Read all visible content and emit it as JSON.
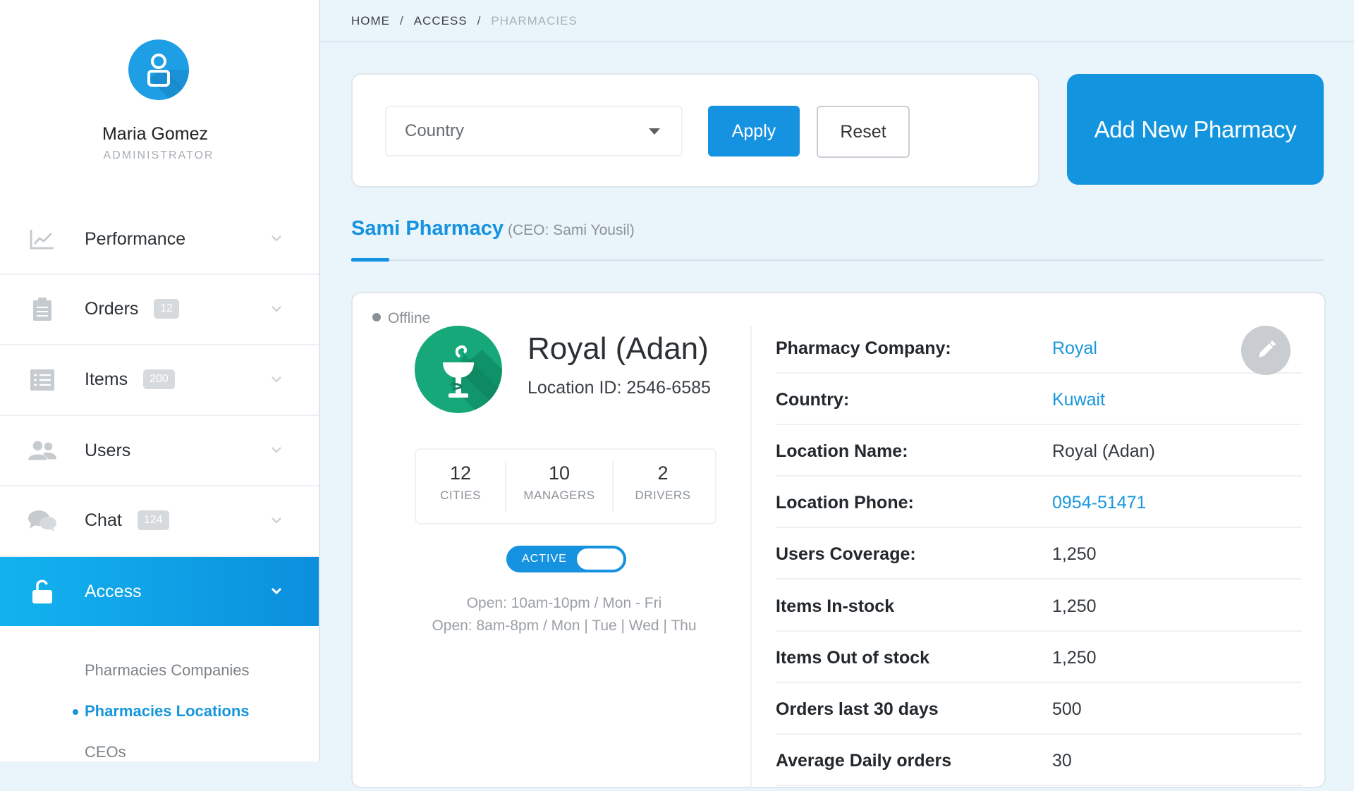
{
  "user": {
    "name": "Maria Gomez",
    "role": "ADMINISTRATOR"
  },
  "nav": {
    "items": [
      {
        "label": "Performance",
        "icon": "chart-icon",
        "badge": ""
      },
      {
        "label": "Orders",
        "icon": "clipboard-icon",
        "badge": "12"
      },
      {
        "label": "Items",
        "icon": "list-icon",
        "badge": "200"
      },
      {
        "label": "Users",
        "icon": "users-icon",
        "badge": ""
      },
      {
        "label": "Chat",
        "icon": "chat-icon",
        "badge": "124"
      },
      {
        "label": "Access",
        "icon": "unlock-icon",
        "badge": "",
        "active": true
      }
    ],
    "sub_items": [
      {
        "label": "Pharmacies Companies"
      },
      {
        "label": "Pharmacies Locations",
        "current": true
      },
      {
        "label": "CEOs"
      }
    ]
  },
  "breadcrumb": {
    "home": "HOME",
    "access": "ACCESS",
    "current": "PHARMACIES",
    "separator": "/"
  },
  "filter": {
    "country_placeholder": "Country",
    "apply_label": "Apply",
    "reset_label": "Reset"
  },
  "add_button_label": "Add New Pharmacy",
  "tab": {
    "name": "Sami Pharmacy",
    "ceo": "(CEO: Sami Yousil)"
  },
  "location": {
    "status": "Offline",
    "name": "Royal (Adan)",
    "location_id": "Location ID: 2546-6585",
    "stats": [
      {
        "value": "12",
        "label": "CITIES"
      },
      {
        "value": "10",
        "label": "MANAGERS"
      },
      {
        "value": "2",
        "label": "DRIVERS"
      }
    ],
    "toggle_label": "ACTIVE",
    "toggle_on": true,
    "hours": [
      "Open: 10am-10pm / Mon - Fri",
      "Open: 8am-8pm / Mon | Tue | Wed | Thu"
    ]
  },
  "details": [
    {
      "label": "Pharmacy Company:",
      "value": "Royal",
      "link": true
    },
    {
      "label": "Country:",
      "value": "Kuwait",
      "link": true
    },
    {
      "label": "Location Name:",
      "value": "Royal (Adan)",
      "link": false
    },
    {
      "label": "Location Phone:",
      "value": "0954-51471",
      "link": true
    },
    {
      "label": "Users Coverage:",
      "value": "1,250",
      "link": false
    },
    {
      "label": "Items In-stock",
      "value": "1,250",
      "link": false
    },
    {
      "label": "Items Out of stock",
      "value": "1,250",
      "link": false
    },
    {
      "label": "Orders last 30 days",
      "value": "500",
      "link": false
    },
    {
      "label": "Average Daily orders",
      "value": "30",
      "link": false
    }
  ],
  "colors": {
    "accent": "#1592e0",
    "active_nav": "#0f9fe6",
    "logo": "#16a878",
    "link": "#1797db"
  }
}
